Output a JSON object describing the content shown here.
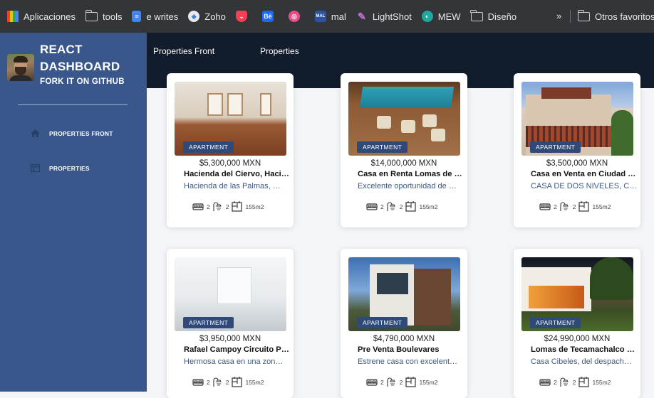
{
  "bookmarks": {
    "items": [
      {
        "label": "Aplicaciones",
        "icon": "apps-grid-icon"
      },
      {
        "label": "tools",
        "icon": "folder-icon"
      },
      {
        "label": "e writes",
        "icon": "docs-icon"
      },
      {
        "label": "Zoho",
        "icon": "zoho-icon"
      },
      {
        "label": "",
        "icon": "pocket-icon"
      },
      {
        "label": "",
        "icon": "behance-icon",
        "glyph": "Bē"
      },
      {
        "label": "",
        "icon": "dribbble-icon"
      },
      {
        "label": "mal",
        "icon": "mal-icon",
        "glyph": "MAL"
      },
      {
        "label": "LightShot",
        "icon": "lightshot-icon"
      },
      {
        "label": "MEW",
        "icon": "mew-icon"
      },
      {
        "label": "Diseño",
        "icon": "folder-icon"
      }
    ],
    "overflow": "»",
    "other_folder": "Otros favoritos"
  },
  "sidebar": {
    "brand_line1": "REACT",
    "brand_line2": "DASHBOARD",
    "fork_link": "FORK IT ON GITHUB",
    "nav": [
      {
        "label": "PROPERTIES FRONT",
        "icon": "home-icon"
      },
      {
        "label": "PROPERTIES",
        "icon": "table-icon"
      }
    ]
  },
  "header": {
    "tabs": [
      "Properties Front",
      "Properties"
    ]
  },
  "properties": [
    {
      "type": "APARTMENT",
      "price": "$5,300,000 MXN",
      "title": "Hacienda del Ciervo, Haci…",
      "desc": "Hacienda de las Palmas, …",
      "beds": "2",
      "baths": "2",
      "area": "155m2"
    },
    {
      "type": "APARTMENT",
      "price": "$14,000,000 MXN",
      "title": "Casa en Renta Lomas de …",
      "desc": "Excelente oportunidad de …",
      "beds": "2",
      "baths": "2",
      "area": "155m2"
    },
    {
      "type": "APARTMENT",
      "price": "$3,500,000 MXN",
      "title": "Casa en Venta en Ciudad …",
      "desc": "CASA DE DOS NIVELES, C…",
      "beds": "2",
      "baths": "2",
      "area": "155m2"
    },
    {
      "type": "APARTMENT",
      "price": "$3,950,000 MXN",
      "title": "Rafael Campoy Circuito P…",
      "desc": "Hermosa casa en una zon…",
      "beds": "2",
      "baths": "2",
      "area": "155m2"
    },
    {
      "type": "APARTMENT",
      "price": "$4,790,000 MXN",
      "title": "Pre Venta Boulevares",
      "desc": "Estrene casa con excelent…",
      "beds": "2",
      "baths": "2",
      "area": "155m2"
    },
    {
      "type": "APARTMENT",
      "price": "$24,990,000 MXN",
      "title": "Lomas de Tecamachalco …",
      "desc": "Casa Cibeles, del despach…",
      "beds": "2",
      "baths": "2",
      "area": "155m2"
    }
  ],
  "colors": {
    "sidebar": "#39578b",
    "header": "#111c2c",
    "badge": "#2f4a78",
    "desc_text": "#3c5a86"
  }
}
